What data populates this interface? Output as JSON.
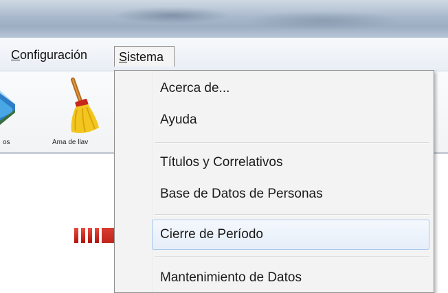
{
  "menubar": {
    "configuracion": {
      "first": "C",
      "rest": "onfiguración"
    },
    "sistema": {
      "first": "S",
      "rest": "istema"
    }
  },
  "toolbar": {
    "items": [
      {
        "label": "os",
        "icon": "blue-book-icon"
      },
      {
        "label": "Ama de llav",
        "icon": "broom-icon"
      }
    ]
  },
  "sistema_menu": {
    "items": [
      {
        "label": "Acerca de..."
      },
      {
        "label": "Ayuda"
      },
      {
        "label": "Títulos y Correlativos"
      },
      {
        "label": "Base de Datos de Personas"
      },
      {
        "label": "Cierre de Período",
        "highlighted": true
      },
      {
        "label": "Mantenimiento de Datos"
      }
    ]
  },
  "annotation": {
    "icon": "red-arrow-icon",
    "color": "#d21f1f"
  }
}
